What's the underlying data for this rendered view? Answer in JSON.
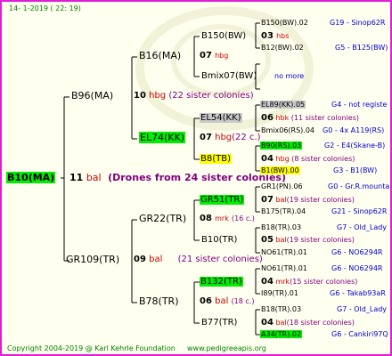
{
  "header": {
    "date": "14- 1-2019 ( 22: 19)"
  },
  "root": {
    "id": "B10(MA)",
    "num": "11",
    "tag": "bal",
    "note": "(Drones from 24 sister colonies)"
  },
  "g1": [
    {
      "id": "B96(MA)",
      "num": "10",
      "tag": "hbg",
      "note": "(22 sister colonies)"
    },
    {
      "id": "GR109(TR)",
      "num": "09",
      "tag": "bal",
      "note": "(21 sister colonies)"
    }
  ],
  "g2": [
    {
      "id": "B16(MA)",
      "num": "07",
      "tag": "hbg",
      "note": ""
    },
    {
      "id": "EL74(KK)",
      "num": "07",
      "tag": "hbg",
      "note": "(22 c.)"
    },
    {
      "id": "GR22(TR)",
      "num": "08",
      "tag": "mrk",
      "note": "(16 c.)"
    },
    {
      "id": "B78(TR)",
      "num": "06",
      "tag": "bal",
      "note": "(18 c.)"
    }
  ],
  "g3": [
    {
      "id": "B150(BW)",
      "num": "03",
      "tag": "hbs",
      "note": ""
    },
    {
      "id": "Bmix07(BW)",
      "num": "",
      "tag": "",
      "note": "no more"
    },
    {
      "id": "EL54(KK)",
      "num": "06",
      "tag": "hbk",
      "note": "(11 sister colonies)"
    },
    {
      "id": "B8(TB)",
      "num": "04",
      "tag": "hbg",
      "note": "(8 sister colonies)"
    },
    {
      "id": "GR51(TR)",
      "num": "07",
      "tag": "bal",
      "note": "(19 sister colonies)"
    },
    {
      "id": "B10(TR)",
      "num": "05",
      "tag": "bal",
      "note": "(19 sister colonies)"
    },
    {
      "id": "B132(TR)",
      "num": "04",
      "tag": "mrk",
      "note": "(15 sister colonies)"
    },
    {
      "id": "B77(TR)",
      "num": "04",
      "tag": "bal",
      "note": "(18 sister colonies)"
    }
  ],
  "g4": [
    {
      "id": "B150(BW).02",
      "info": "G19 - Sinop62R"
    },
    {
      "id": "B12(BW).02",
      "info": "G5 - B125(BW)"
    },
    {
      "id": "EL89(KK).05",
      "info": "G4 - not registe"
    },
    {
      "id": "Bmix06(RS).04",
      "info": "G0 - 4x A119(RS)"
    },
    {
      "id": "B90(RS).03",
      "info": "G2 - E4(Skane-B)"
    },
    {
      "id": "B1(BW).00",
      "info": "G3 - B1(BW)"
    },
    {
      "id": "GR1(PN).06",
      "info": "G0 - Gr.R.mounta"
    },
    {
      "id": "B175(TR).04",
      "info": "G21 - Sinop62R"
    },
    {
      "id": "B18(TR).03",
      "info": "G7 - Old_Lady"
    },
    {
      "id": "NO61(TR).01",
      "info": "G6 - NO6294R"
    },
    {
      "id": "NO61(TR).01",
      "info": "G6 - NO6294R"
    },
    {
      "id": "I89(TR).01",
      "info": "G6 - Takab93aR"
    },
    {
      "id": "B18(TR).03",
      "info": "G7 - Old_Lady"
    },
    {
      "id": "A34(TR).02",
      "info": "G6 - Cankiri97Q"
    }
  ],
  "footer": {
    "copyright": "Copyright 2004-2019 @ Karl Kehrle Foundation",
    "url": "www.pedigreeapis.org"
  },
  "colors": {
    "frame": "#e31bd9",
    "background": "#fffff0",
    "highlight_green": "#00ee00",
    "highlight_yellow": "#ffff00",
    "highlight_gray": "#c8c8c8",
    "tag_red": "#cc0000",
    "note_purple": "#800080",
    "info_blue": "#0000cc",
    "footer_green": "#008000"
  }
}
